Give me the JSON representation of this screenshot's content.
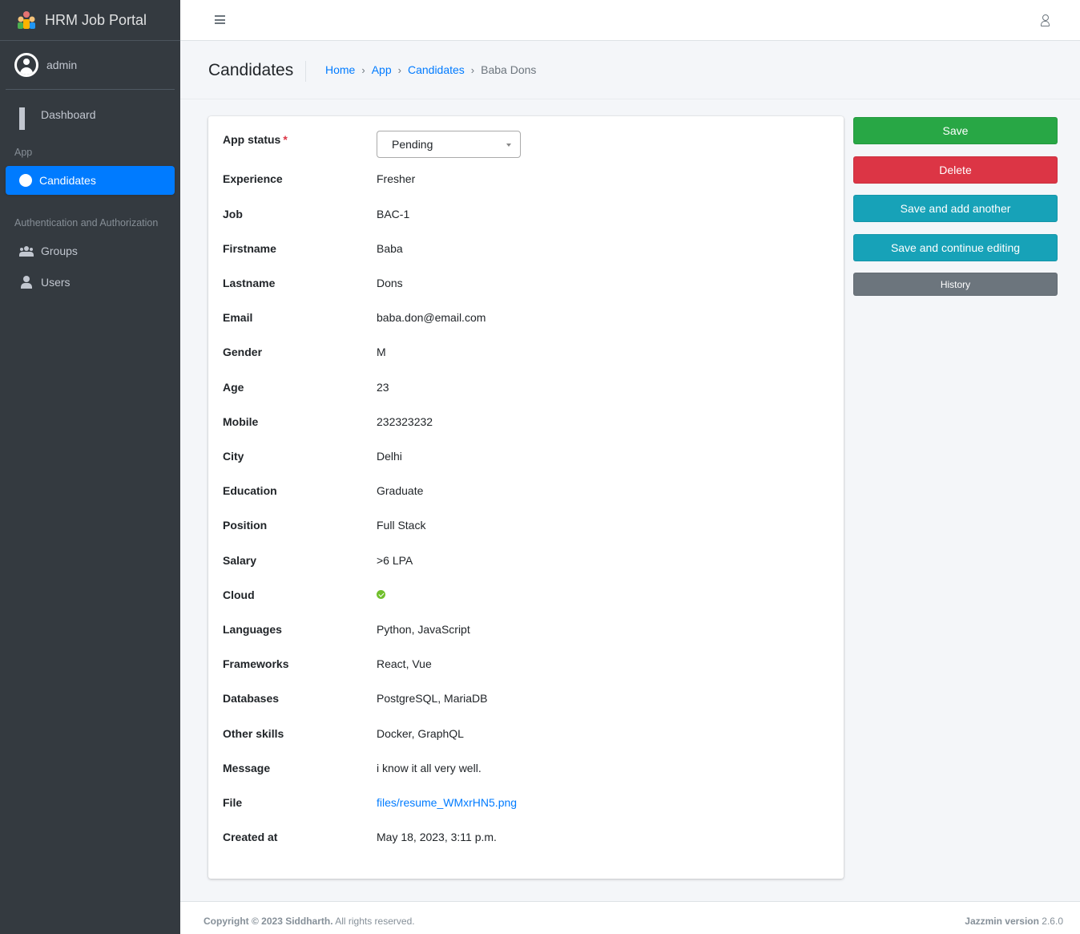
{
  "brand": {
    "title": "HRM Job Portal"
  },
  "user": {
    "name": "admin"
  },
  "sidebar": {
    "dashboard": "Dashboard",
    "section_app": "App",
    "candidates": "Candidates",
    "section_auth": "Authentication and Authorization",
    "groups": "Groups",
    "users": "Users"
  },
  "header": {
    "title": "Candidates",
    "breadcrumb": [
      "Home",
      "App",
      "Candidates",
      "Baba Dons"
    ]
  },
  "form": {
    "app_status": {
      "label": "App status",
      "required_mark": "*",
      "value": "Pending"
    },
    "fields": [
      {
        "label": "Experience",
        "value": "Fresher"
      },
      {
        "label": "Job",
        "value": "BAC-1"
      },
      {
        "label": "Firstname",
        "value": "Baba"
      },
      {
        "label": "Lastname",
        "value": "Dons"
      },
      {
        "label": "Email",
        "value": "baba.don@email.com"
      },
      {
        "label": "Gender",
        "value": "M"
      },
      {
        "label": "Age",
        "value": "23"
      },
      {
        "label": "Mobile",
        "value": "232323232"
      },
      {
        "label": "City",
        "value": "Delhi"
      },
      {
        "label": "Education",
        "value": "Graduate"
      },
      {
        "label": "Position",
        "value": "Full Stack"
      },
      {
        "label": "Salary",
        "value": ">6 LPA"
      },
      {
        "label": "Cloud",
        "value": ""
      },
      {
        "label": "Languages",
        "value": "Python, JavaScript"
      },
      {
        "label": "Frameworks",
        "value": "React, Vue"
      },
      {
        "label": "Databases",
        "value": "PostgreSQL, MariaDB"
      },
      {
        "label": "Other skills",
        "value": "Docker, GraphQL"
      },
      {
        "label": "Message",
        "value": "i know it all very well."
      },
      {
        "label": "File",
        "value": "files/resume_WMxrHN5.png"
      },
      {
        "label": "Created at",
        "value": "May 18, 2023, 3:11 p.m."
      }
    ]
  },
  "actions": {
    "save": "Save",
    "delete": "Delete",
    "save_add": "Save and add another",
    "save_continue": "Save and continue editing",
    "history": "History"
  },
  "footer": {
    "copyright_bold": "Copyright © 2023 Siddharth.",
    "copyright_rest": " All rights reserved.",
    "version_label": "Jazzmin version",
    "version": " 2.6.0"
  },
  "colors": {
    "primary": "#007bff",
    "success": "#28a745",
    "danger": "#dc3545",
    "info": "#17a2b8",
    "secondary": "#6c757d",
    "sidebar": "#343a40"
  }
}
